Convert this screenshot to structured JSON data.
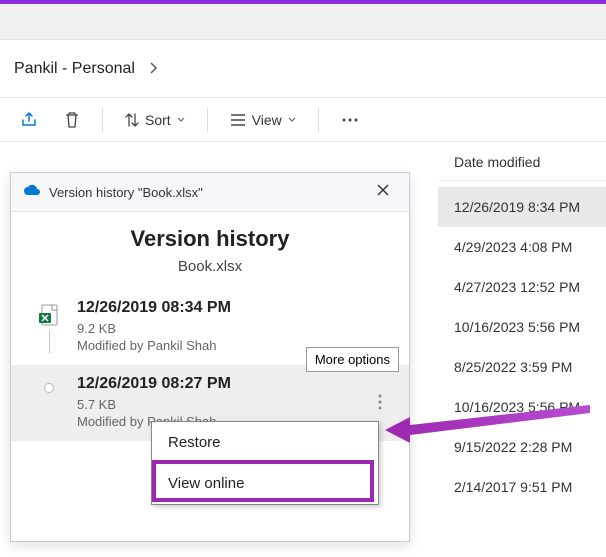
{
  "breadcrumb": {
    "path": "Pankil - Personal"
  },
  "toolbar": {
    "sort": "Sort",
    "view": "View"
  },
  "columns": {
    "date_modified": "Date modified"
  },
  "dates": [
    "12/26/2019 8:34 PM",
    "4/29/2023 4:08 PM",
    "4/27/2023 12:52 PM",
    "10/16/2023 5:56 PM",
    "8/25/2022 3:59 PM",
    "10/16/2023 5:56 PM",
    "9/15/2022 2:28 PM",
    "2/14/2017 9:51 PM"
  ],
  "dialog": {
    "window_title": "Version history \"Book.xlsx\"",
    "heading": "Version history",
    "filename": "Book.xlsx",
    "more_tooltip": "More options",
    "versions": [
      {
        "date": "12/26/2019 08:34 PM",
        "size": "9.2 KB",
        "modified": "Modified by Pankil Shah"
      },
      {
        "date": "12/26/2019 08:27 PM",
        "size": "5.7 KB",
        "modified": "Modified by Pankil Shah"
      }
    ]
  },
  "menu": {
    "restore": "Restore",
    "view_online": "View online"
  }
}
